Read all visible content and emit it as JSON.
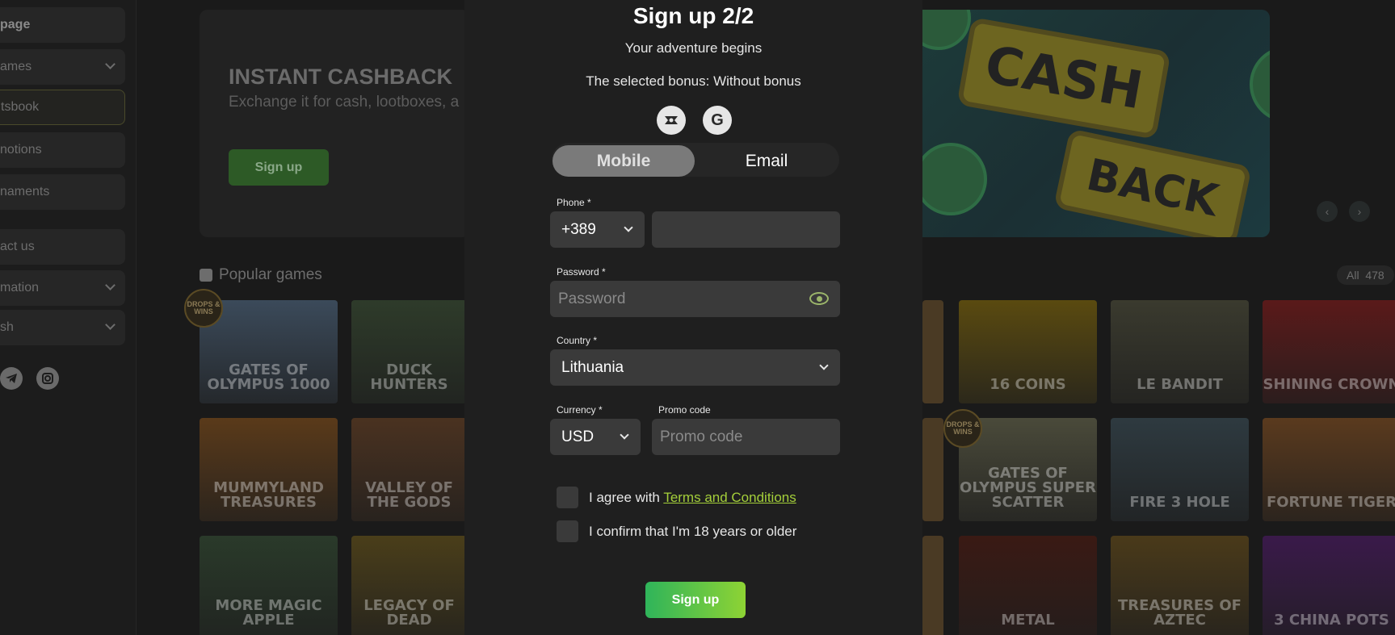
{
  "sidebar": {
    "items": [
      {
        "label": "page"
      },
      {
        "label": "ames"
      },
      {
        "label": "tsbook"
      },
      {
        "label": "notions"
      },
      {
        "label": "naments"
      },
      {
        "label": "act us"
      },
      {
        "label": "mation"
      },
      {
        "label": "sh"
      }
    ],
    "social_icons": [
      "telegram-icon",
      "instagram-icon"
    ]
  },
  "banner": {
    "title": "INSTANT CASHBACK",
    "subtitle": "Exchange it for cash, lootboxes, a",
    "button": "Sign up",
    "art_text_1": "CASH",
    "art_text_2": "BACK"
  },
  "popular": {
    "title": "Popular games",
    "all_label": "All",
    "all_count": "478"
  },
  "games": [
    {
      "name": "GATES OF OLYMPUS 1000",
      "color": "#3b4a5a"
    },
    {
      "name": "DUCK HUNTERS",
      "color": "#2e3b2a"
    },
    {
      "name": "MUMMYLAND TREASURES",
      "color": "#5a3a1a"
    },
    {
      "name": "VALLEY OF THE GODS",
      "color": "#4a3220"
    },
    {
      "name": "MORE MAGIC APPLE",
      "color": "#2a3a2a"
    },
    {
      "name": "LEGACY OF DEAD",
      "color": "#4a3e1a"
    },
    {
      "name": "16 COINS",
      "color": "#5a4a10"
    },
    {
      "name": "LE BANDIT",
      "color": "#3a3a2e"
    },
    {
      "name": "SHINING CROWN",
      "color": "#5a1a1a"
    },
    {
      "name": "GATES OF OLYMPUS SUPER SCATTER",
      "color": "#4a4a3a"
    },
    {
      "name": "FIRE 3 HOLE",
      "color": "#2e3a40"
    },
    {
      "name": "FORTUNE TIGER",
      "color": "#5a3a1e"
    },
    {
      "name": "METAL",
      "color": "#3a1a14"
    },
    {
      "name": "TREASURES OF AZTEC",
      "color": "#4a3a1a"
    },
    {
      "name": "3 CHINA POTS",
      "color": "#3a1a4a"
    }
  ],
  "drops_badge": "DROPS & WINS",
  "modal": {
    "title": "Sign up 2/2",
    "subtitle": "Your adventure begins",
    "bonus": "The selected bonus: Without bonus",
    "tabs": {
      "mobile": "Mobile",
      "email": "Email"
    },
    "phone_label": "Phone *",
    "phone_code": "+389",
    "password_label": "Password *",
    "password_placeholder": "Password",
    "country_label": "Country *",
    "country_value": "Lithuania",
    "currency_label": "Currency *",
    "currency_value": "USD",
    "promo_label": "Promo code",
    "promo_placeholder": "Promo code",
    "agree_text": "I agree with",
    "terms_link": "Terms and Conditions",
    "age_text": "I confirm that I'm 18 years or older",
    "submit": "Sign up"
  },
  "colors": {
    "accent_green": "#8ed334",
    "link_green": "#a4cf3a",
    "modal_bg": "#1f1f1f",
    "field_bg": "#3a3a3a"
  }
}
